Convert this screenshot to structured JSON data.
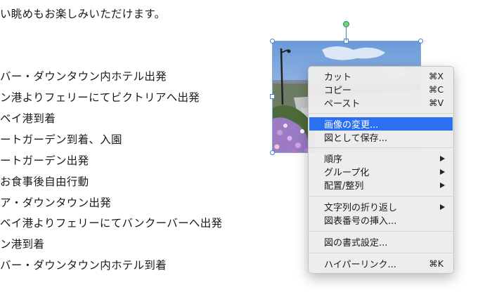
{
  "document": {
    "lines": [
      "い眺めもお楽しみいただけます。",
      "バー・ダウンタウン内ホテル出発",
      "ン港よりフェリーにてビクトリアへ出発",
      "ベイ港到着",
      "ートガーデン到着、入園",
      "ートガーデン出発",
      "お食事後自由行動",
      "ア・ダウンタウン出発",
      "ベイ港よりフェリーにてバンクーバーへ出発",
      "ン港到着",
      "バー・ダウンタウン内ホテル到着"
    ]
  },
  "context_menu": {
    "groups": [
      [
        {
          "label": "カット",
          "shortcut": "⌘X"
        },
        {
          "label": "コピー",
          "shortcut": "⌘C"
        },
        {
          "label": "ペースト",
          "shortcut": "⌘V"
        }
      ],
      [
        {
          "label": "画像の変更...",
          "highlighted": true
        },
        {
          "label": "図として保存..."
        }
      ],
      [
        {
          "label": "順序",
          "submenu": true
        },
        {
          "label": "グループ化",
          "submenu": true
        },
        {
          "label": "配置/整列",
          "submenu": true
        }
      ],
      [
        {
          "label": "文字列の折り返し",
          "submenu": true
        },
        {
          "label": "図表番号の挿入..."
        }
      ],
      [
        {
          "label": "図の書式設定..."
        }
      ],
      [
        {
          "label": "ハイパーリンク...",
          "shortcut": "⌘K"
        }
      ]
    ]
  },
  "colors": {
    "highlight": "#2b6ff3",
    "rotation_handle": "#6fd27b",
    "selection_border": "#4a7fc9"
  }
}
